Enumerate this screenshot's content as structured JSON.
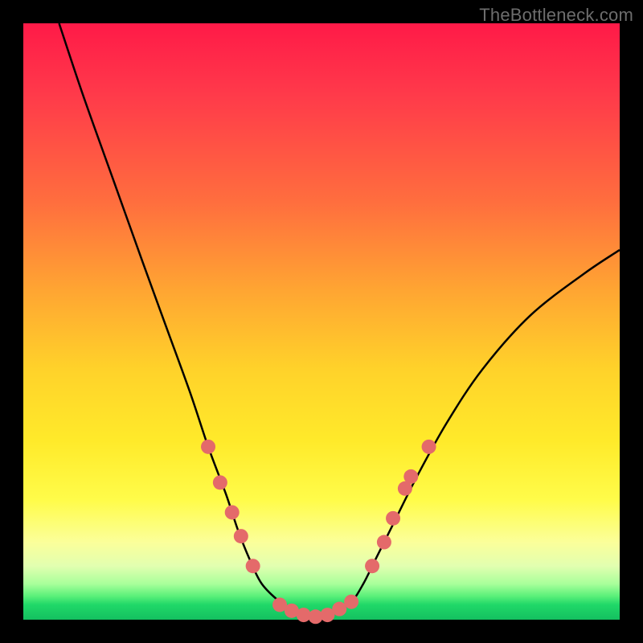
{
  "watermark": "TheBottleneck.com",
  "chart_data": {
    "type": "line",
    "title": "",
    "xlabel": "",
    "ylabel": "",
    "xlim": [
      0,
      100
    ],
    "ylim": [
      0,
      100
    ],
    "background_gradient_stops": [
      {
        "pos": 0,
        "color": "#ff1a48"
      },
      {
        "pos": 12,
        "color": "#ff3a4a"
      },
      {
        "pos": 30,
        "color": "#ff6e3e"
      },
      {
        "pos": 45,
        "color": "#ffa632"
      },
      {
        "pos": 58,
        "color": "#ffd22a"
      },
      {
        "pos": 70,
        "color": "#ffea2a"
      },
      {
        "pos": 80,
        "color": "#fffc4a"
      },
      {
        "pos": 87,
        "color": "#fbff9a"
      },
      {
        "pos": 91,
        "color": "#e2ffb0"
      },
      {
        "pos": 94,
        "color": "#a8ff9a"
      },
      {
        "pos": 96,
        "color": "#5cf07a"
      },
      {
        "pos": 97.5,
        "color": "#20d868"
      },
      {
        "pos": 100,
        "color": "#14c060"
      }
    ],
    "series": [
      {
        "name": "bottleneck-curve",
        "color": "#000000",
        "x": [
          6,
          10,
          15,
          20,
          24,
          28,
          31,
          34,
          36,
          38,
          40,
          43,
          46,
          49,
          52,
          55,
          57,
          59,
          62,
          66,
          71,
          77,
          85,
          94,
          100
        ],
        "y": [
          100,
          88,
          74,
          60,
          49,
          38,
          29,
          21,
          15,
          10,
          6,
          3,
          1,
          0,
          1,
          3,
          6,
          10,
          16,
          24,
          33,
          42,
          51,
          58,
          62
        ]
      }
    ],
    "markers": [
      {
        "name": "curve-dots",
        "color": "#e46a6a",
        "radius": 9,
        "points": [
          {
            "x": 31.0,
            "y": 29
          },
          {
            "x": 33.0,
            "y": 23
          },
          {
            "x": 35.0,
            "y": 18
          },
          {
            "x": 36.5,
            "y": 14
          },
          {
            "x": 38.5,
            "y": 9
          },
          {
            "x": 43.0,
            "y": 2.5
          },
          {
            "x": 45.0,
            "y": 1.5
          },
          {
            "x": 47.0,
            "y": 0.8
          },
          {
            "x": 49.0,
            "y": 0.5
          },
          {
            "x": 51.0,
            "y": 0.8
          },
          {
            "x": 53.0,
            "y": 1.8
          },
          {
            "x": 55.0,
            "y": 3.0
          },
          {
            "x": 58.5,
            "y": 9
          },
          {
            "x": 60.5,
            "y": 13
          },
          {
            "x": 62.0,
            "y": 17
          },
          {
            "x": 64.0,
            "y": 22
          },
          {
            "x": 65.0,
            "y": 24
          },
          {
            "x": 68.0,
            "y": 29
          }
        ]
      }
    ]
  }
}
